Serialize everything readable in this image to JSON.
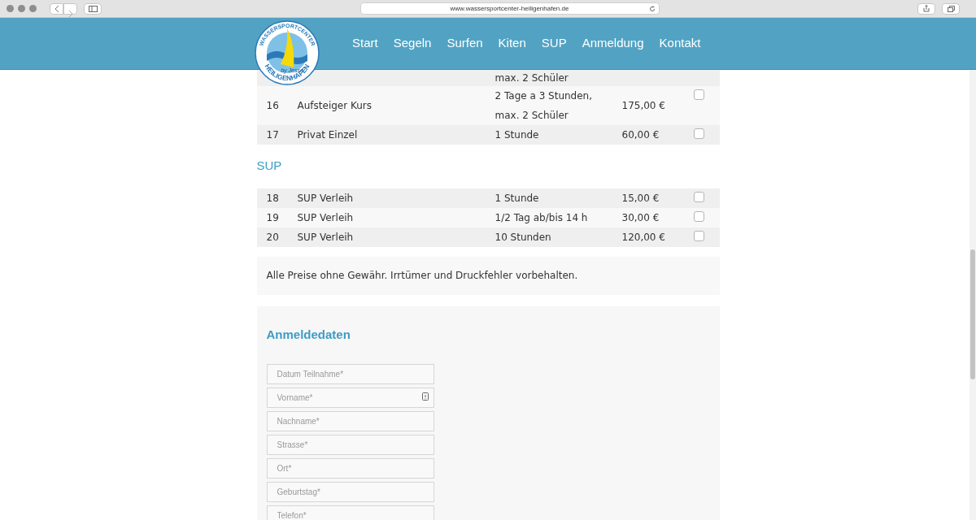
{
  "browser": {
    "url": "www.wassersportcenter-heiligenhafen.de"
  },
  "logo": {
    "top_text": "WASSERSPORTCENTER",
    "bottom_text": "HEILIGENHAFEN",
    "signature": "by Jesse"
  },
  "nav": [
    "Start",
    "Segeln",
    "Surfen",
    "Kiten",
    "SUP",
    "Anmeldung",
    "Kontakt"
  ],
  "partial_row": {
    "description": "max. 2 Schüler"
  },
  "rows_top": [
    {
      "number": "16",
      "name": "Aufsteiger Kurs",
      "description": [
        "2 Tage a 3 Stunden,",
        "max. 2 Schüler"
      ],
      "price": "175,00 €",
      "checked": false
    },
    {
      "number": "17",
      "name": "Privat Einzel",
      "description": [
        "1 Stunde"
      ],
      "price": "60,00 €",
      "checked": false
    }
  ],
  "section_heading": "SUP",
  "rows_sup": [
    {
      "number": "18",
      "name": "SUP Verleih",
      "description": [
        "1 Stunde"
      ],
      "price": "15,00 €",
      "checked": false
    },
    {
      "number": "19",
      "name": "SUP Verleih",
      "description": [
        "1/2 Tag ab/bis 14 h"
      ],
      "price": "30,00 €",
      "checked": false
    },
    {
      "number": "20",
      "name": "SUP Verleih",
      "description": [
        "10 Stunden"
      ],
      "price": "120,00 €",
      "checked": false
    }
  ],
  "note": "Alle Preise ohne Gewähr. Irrtümer und Druckfehler vorbehalten.",
  "form": {
    "heading": "Anmeldedaten",
    "fields": [
      {
        "placeholder": "Datum Teilnahme*"
      },
      {
        "placeholder": "Vorname*",
        "autofill_icon": true
      },
      {
        "placeholder": "Nachname*"
      },
      {
        "placeholder": "Strasse*"
      },
      {
        "placeholder": "Ort*"
      },
      {
        "placeholder": "Geburtstag*"
      },
      {
        "placeholder": "Telefon*"
      }
    ]
  }
}
